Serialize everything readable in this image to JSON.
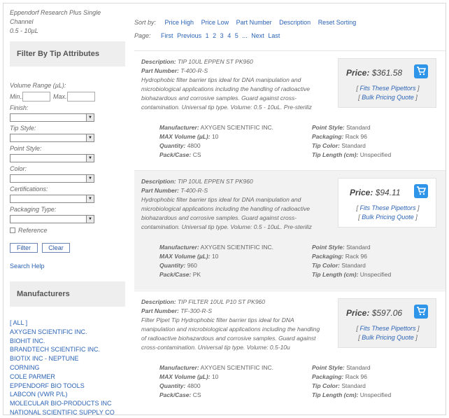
{
  "breadcrumb": {
    "line1": "Eppendorf Research Plus Single Channel",
    "line2": "0.5 - 10µL"
  },
  "filter_panel": {
    "title": "Filter By Tip Attributes",
    "volume_label": "Volume Range (µL):",
    "min_label": "Min.:",
    "max_label": "Max.:",
    "fields": [
      "Finish:",
      "Tip Style:",
      "Point Style:",
      "Color:",
      "Certifications:",
      "Packaging Type:"
    ],
    "reference_label": "Reference",
    "filter_button": "Filter",
    "clear_button": "Clear",
    "search_help": "Search Help"
  },
  "manufacturers": {
    "title": "Manufacturers",
    "items": [
      "[ ALL ]",
      "AXYGEN SCIENTIFIC INC.",
      "BIOHIT INC.",
      "BRANDTECH SCIENTIFIC INC.",
      "BIOTIX INC - NEPTUNE",
      "CORNING",
      "COLE PARMER",
      "EPPENDORF BIO TOOLS",
      "LABCON (VWR P/L)",
      "MOLECULAR BIO-PRODUCTS INC",
      "NATIONAL SCIENTIFIC SUPPLY CO"
    ]
  },
  "sort": {
    "label": "Sort by:",
    "options": [
      "Price High",
      "Price Low",
      "Part Number",
      "Description",
      "Reset Sorting"
    ]
  },
  "pagination": {
    "label": "Page:",
    "first": "First",
    "previous": "Previous",
    "pages": [
      "1",
      "2",
      "3",
      "4",
      "5"
    ],
    "ellipsis": "...",
    "next": "Next",
    "last": "Last"
  },
  "labels": {
    "description": "Description:",
    "part_number": "Part Number:",
    "price": "Price:",
    "fits": "Fits These Pipettors",
    "bulk": "Bulk Pricing Quote",
    "manufacturer": "Manufacturer:",
    "max_volume": "MAX Volume (µL):",
    "quantity": "Quantity:",
    "pack_case": "Pack/Case:",
    "point_style": "Point Style:",
    "packaging": "Packaging:",
    "tip_color": "Tip Color:",
    "tip_length": "Tip Length (cm):"
  },
  "products": [
    {
      "description": "TIP 10UL EPPEN ST PK960",
      "part_number": "T-400-R-S",
      "text": "Hydrophobic filter barrier tips ideal for DNA manipulation and microbiological applications including the handling of radioactive biohazardous and corrosive samples. Guard against cross-contamination. Universal tip type. Volume: 0.5 - 10uL. Pre-steriliz",
      "price": "$361.58",
      "manufacturer": "AXYGEN SCIENTIFIC INC.",
      "max_volume": "10",
      "quantity": "4800",
      "pack_case": "CS",
      "point_style": "Standard",
      "packaging": "Rack 96",
      "tip_color": "Standard",
      "tip_length": "Unspecified"
    },
    {
      "description": "TIP 10UL EPPEN ST PK960",
      "part_number": "T-400-R-S",
      "text": "Hydrophobic filter barrier tips ideal for DNA manipulation and microbiological applications including the handling of radioactive biohazardous and corrosive samples. Guard against cross-contamination. Universal tip type. Volume: 0.5 - 10uL. Pre-steriliz",
      "price": "$94.11",
      "manufacturer": "AXYGEN SCIENTIFIC INC.",
      "max_volume": "10",
      "quantity": "960",
      "pack_case": "PK",
      "point_style": "Standard",
      "packaging": "Rack 96",
      "tip_color": "Standard",
      "tip_length": "Unspecified"
    },
    {
      "description": "TIP FILTER 10UL P10 ST PK960",
      "part_number": "TF-300-R-S",
      "text": "Filter Pipet Tip Hydrophobic filter barrier tips ideal for DNA manipulation and microbiological applications including the handling of radioactive biohazardous and corrosive samples. Guard against cross-contamination. Universal tip type. Volume: 0.5-10u",
      "price": "$597.06",
      "manufacturer": "AXYGEN SCIENTIFIC INC.",
      "max_volume": "10",
      "quantity": "4800",
      "pack_case": "CS",
      "point_style": "Standard",
      "packaging": "Rack 96",
      "tip_color": "Standard",
      "tip_length": "Unspecified"
    }
  ],
  "colors": {
    "link": "#2b63b5",
    "cart": "#2f95e8",
    "panel": "#eeeeee"
  }
}
